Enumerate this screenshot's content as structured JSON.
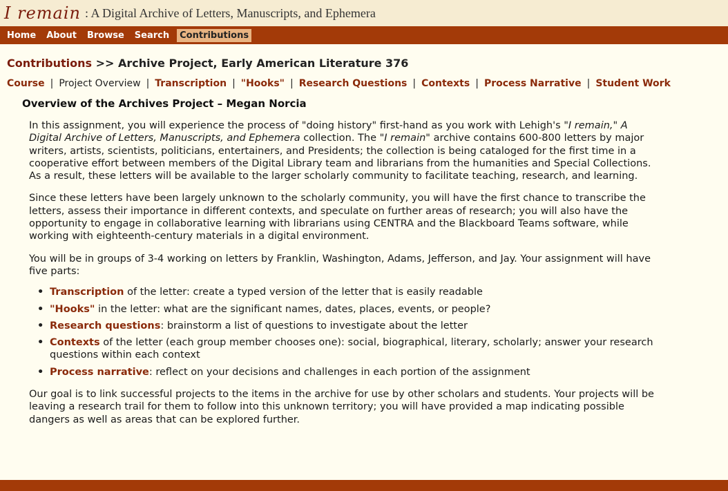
{
  "header": {
    "logo_script": "I remain",
    "title": ": A Digital Archive of Letters, Manuscripts, and Ephemera"
  },
  "nav": {
    "items": [
      "Home",
      "About",
      "Browse",
      "Search",
      "Contributions"
    ],
    "active": "Contributions"
  },
  "breadcrumb": {
    "link": "Contributions",
    "rest": " >> Archive Project, Early American Literature 376"
  },
  "subnav": {
    "items": [
      "Course",
      "Project Overview",
      "Transcription",
      "\"Hooks\"",
      "Research Questions",
      "Contexts",
      "Process Narrative",
      "Student Work"
    ],
    "current": "Project Overview"
  },
  "main": {
    "title": "Overview of the Archives Project – Megan Norcia",
    "p1": {
      "a": "In this assignment, you will experience the process of \"doing history\" first-hand as you work with Lehigh's ",
      "b": "\"I remain,\" A Digital Archive of Letters, Manuscripts, and Ephemera",
      "c": " collection. The ",
      "d": "\"I remain\"",
      "e": " archive contains 600-800 letters by major writers, artists, scientists, politicians, entertainers, and Presidents; the collection is being cataloged for the first time in a cooperative effort between members of the Digital Library team and librarians from the humanities and Special Collections. As a result, these letters will be available to the larger scholarly community to facilitate teaching, research, and learning."
    },
    "p2": "Since these letters have been largely unknown to the scholarly community, you will have the first chance to transcribe the letters, assess their importance in different contexts, and speculate on further areas of research; you will also have the opportunity to engage in collaborative learning with librarians using CENTRA and the Blackboard Teams software, while working with eighteenth-century materials in a digital environment.",
    "p3": "You will be in groups of 3-4 working on letters by Franklin, Washington, Adams, Jefferson, and Jay. Your assignment will have five parts:",
    "parts": [
      {
        "term": "Transcription",
        "text": " of the letter: create a typed version of the letter that is easily readable"
      },
      {
        "term": "\"Hooks\"",
        "text": " in the letter: what are the significant names, dates, places, events, or people?"
      },
      {
        "term": "Research questions",
        "text": ": brainstorm a list of questions to investigate about the letter"
      },
      {
        "term": "Contexts",
        "text": " of the letter (each group member chooses one): social, biographical, literary, scholarly; answer your research questions within each context"
      },
      {
        "term": "Process narrative",
        "text": ": reflect on your decisions and challenges in each portion of the assignment"
      }
    ],
    "p4": "Our goal is to link successful projects to the items in the archive for use by other scholars and students. Your projects will be leaving a research trail for them to follow into this unknown territory; you will have provided a map indicating possible dangers as well as areas that can be explored further."
  },
  "colors": {
    "nav_bg": "#a33a08",
    "header_bg": "#f6ecd2",
    "page_bg": "#fffdf0",
    "link": "#8a2a0a",
    "active_tab": "#e9b482"
  }
}
